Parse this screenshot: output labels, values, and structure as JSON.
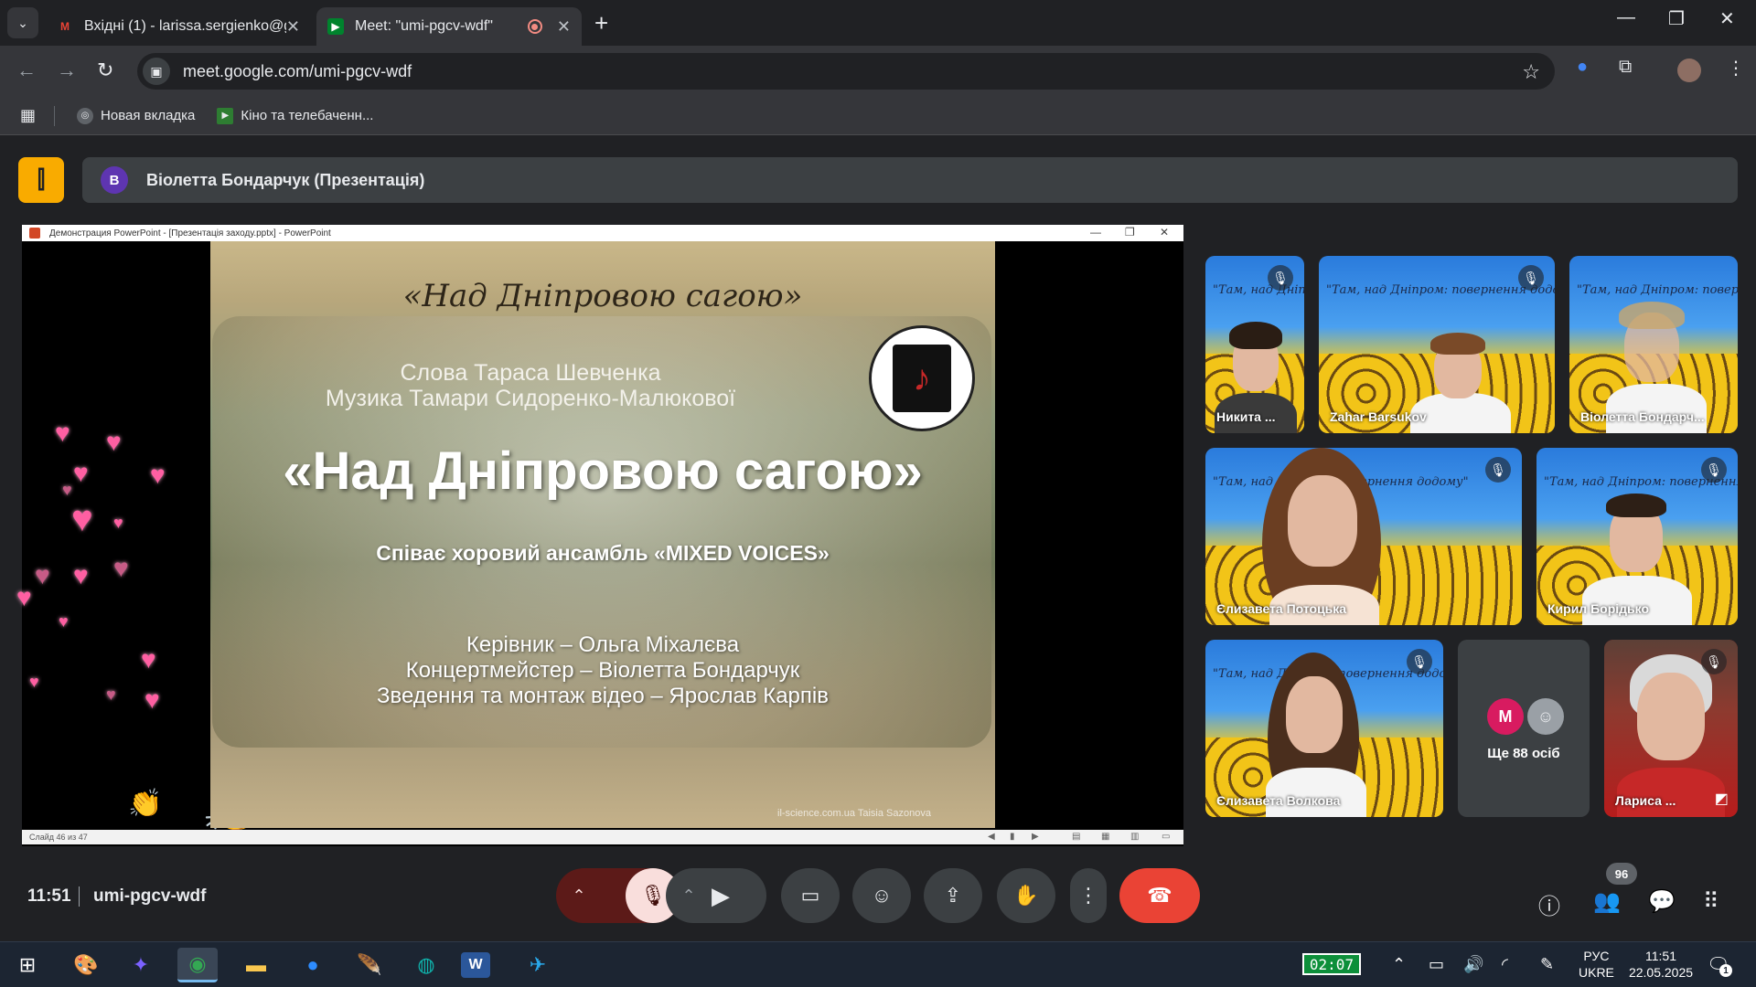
{
  "browser": {
    "tabs": [
      {
        "title": "Вхідні (1) - larissa.sergienko@g",
        "favicon": "gmail-icon"
      },
      {
        "title": "Meet: \"umi-pgcv-wdf\"",
        "favicon": "meet-icon"
      }
    ],
    "url": "meet.google.com/umi-pgcv-wdf",
    "bookmarks": [
      "Новая вкладка",
      "Кіно та телебаченн..."
    ]
  },
  "meet": {
    "presenter_initial": "В",
    "presenter_title": "Віолетта Бондарчук (Презентація)",
    "ppt_window_title": "Демонстрация PowerPoint - [Презентація заходу.pptx] - PowerPoint",
    "ppt_status": "Слайд 46 из 47",
    "slide": {
      "deco_title": "«Над Дніпровою сагою»",
      "words": "Слова Тараса Шевченка",
      "music": "Музика Тамари Сидоренко-Малюкової",
      "main_title": "«Над Дніпровою сагою»",
      "ensemble": "Співає хоровий ансамбль «MIXED VOICES»",
      "credit1": "Керівник – Ольга Міхалєва",
      "credit2": "Концертмейстер – Віолетта Бондарчук",
      "credit3": "Зведення та монтаж відео – Ярослав Карпів",
      "watermark": "il-science.com.ua   Taisia Sazonova"
    },
    "participants": [
      {
        "name": "Никита ..."
      },
      {
        "name": "Zahar Barsukov"
      },
      {
        "name": "Віолетта Бондарч..."
      },
      {
        "name": "Єлизавета Потоцька"
      },
      {
        "name": "Кирил Борідько"
      },
      {
        "name": "Єлизавета Волкова"
      },
      {
        "name": "Лариса ..."
      }
    ],
    "tile_script": "\"Там, над Дніпром: повернення додому\"",
    "more": {
      "initial": "M",
      "label": "Ще 88 осіб"
    },
    "clock": "11:51",
    "meeting_code": "umi-pgcv-wdf",
    "participant_count": "96"
  },
  "taskbar": {
    "timer": "02:07",
    "lang_top": "РУС",
    "lang_bottom": "UKRE",
    "time": "11:51",
    "date": "22.05.2025",
    "notifications": "1"
  }
}
